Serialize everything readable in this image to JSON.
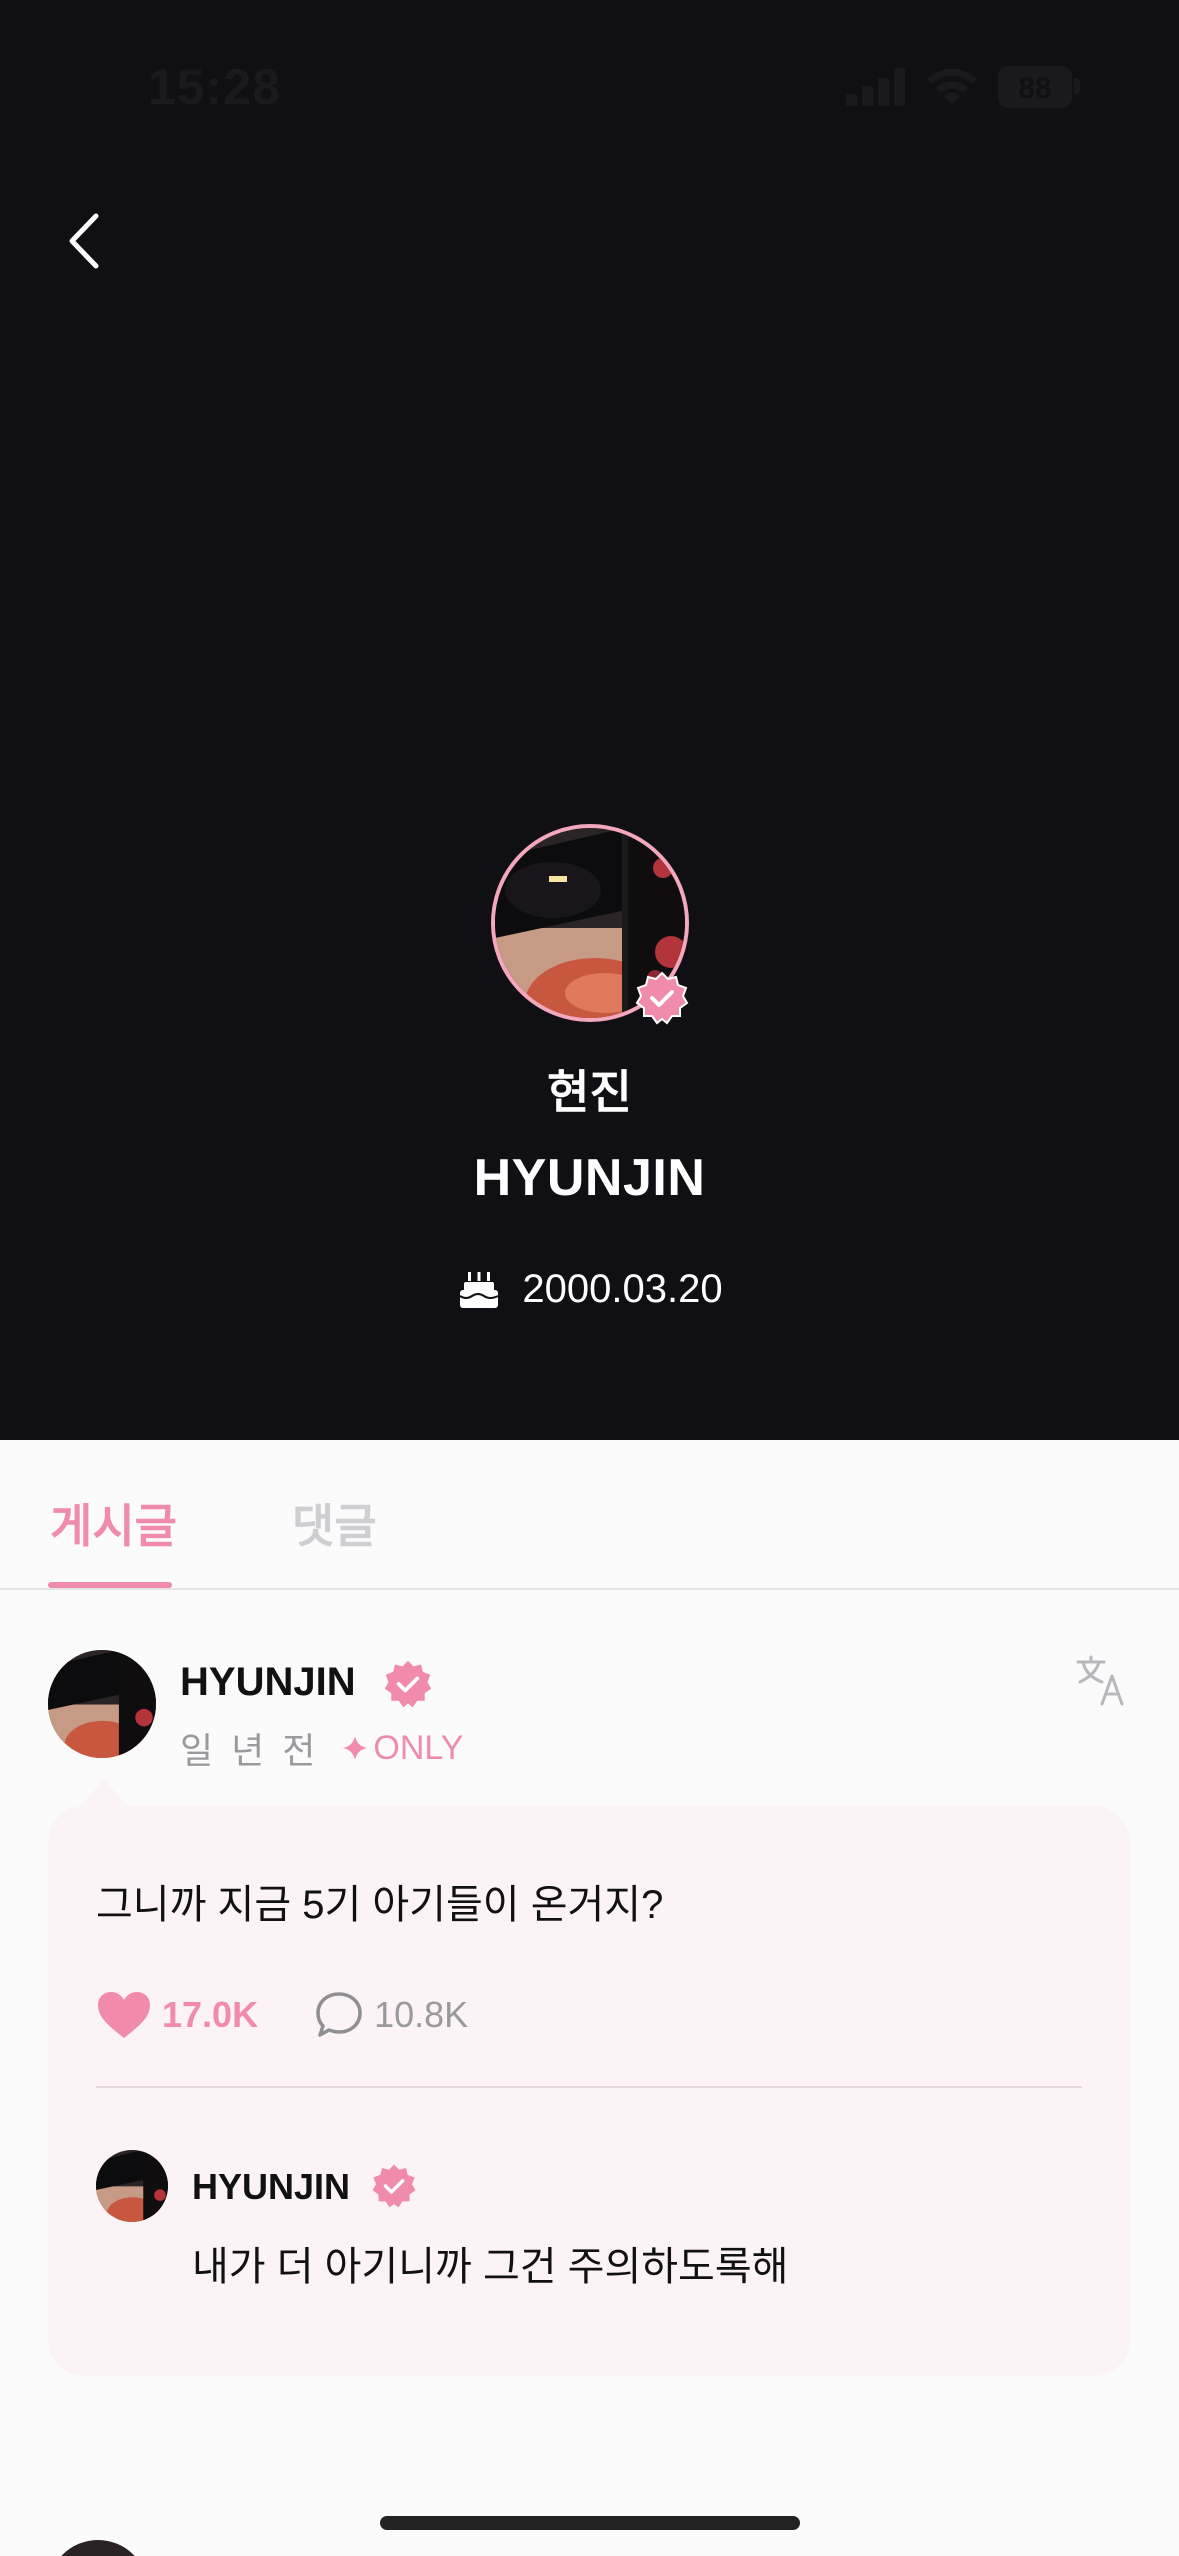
{
  "status_bar": {
    "time": "15:28",
    "battery": "88"
  },
  "profile": {
    "korean_name": "현진",
    "name": "HYUNJIN",
    "birthday": "2000.03.20"
  },
  "tabs": [
    {
      "label": "게시글",
      "active": true
    },
    {
      "label": "댓글",
      "active": false
    }
  ],
  "post": {
    "author": "HYUNJIN",
    "time": "일 년 전",
    "badge": "ONLY",
    "text": "그니까 지금 5기 아기들이 온거지?",
    "likes": "17.0K",
    "comments": "10.8K",
    "reply": {
      "author": "HYUNJIN",
      "text": "내가 더 아기니까 그건 주의하도록해"
    }
  },
  "colors": {
    "accent": "#f08bab",
    "header_bg": "#101014",
    "bubble_bg": "#fcf3f6"
  },
  "icons": [
    "back-chevron-icon",
    "verified-icon",
    "cake-icon",
    "translate-icon",
    "heart-icon",
    "comment-icon",
    "sparkle-icon"
  ]
}
